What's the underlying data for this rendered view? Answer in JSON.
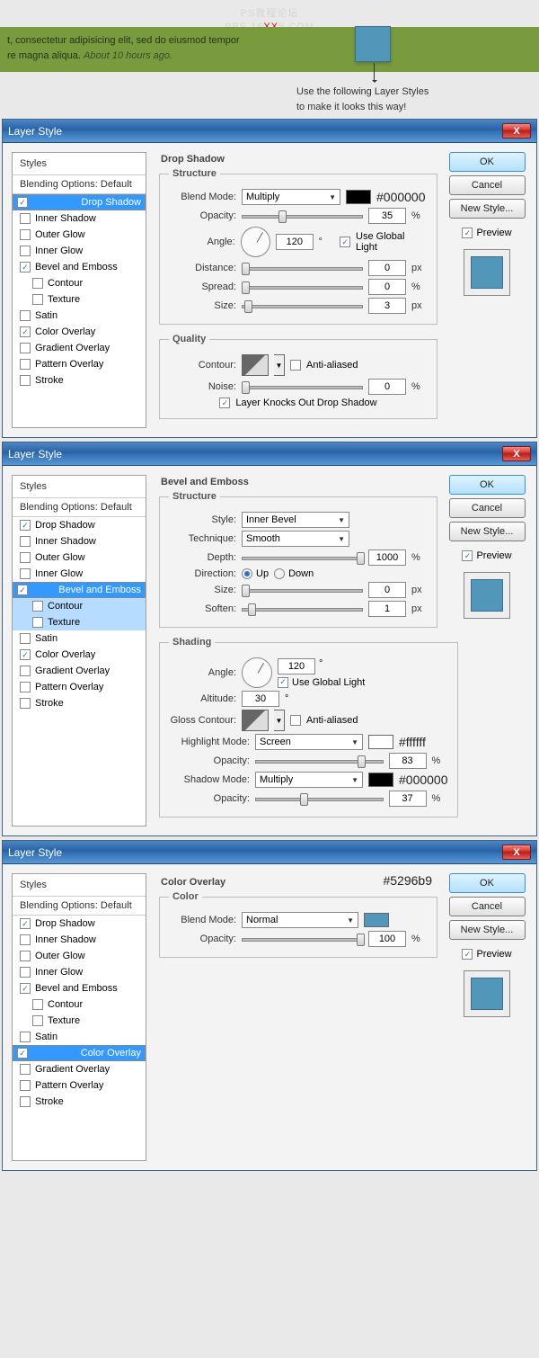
{
  "banner": {
    "watermark1": "PS教程论坛",
    "watermark2_a": "BBS.16",
    "watermark2_b": "XX",
    "watermark2_c": "8.COM",
    "line1": "t, consectetur adipisicing elit, sed do eiusmod tempor",
    "line2": "re magna aliqua.  ",
    "time": "About 10 hours ago.",
    "caption1": "Use the following Layer Styles",
    "caption2": "to make it looks this way!"
  },
  "common": {
    "title": "Layer Style",
    "close": "X",
    "styles_header": "Styles",
    "blend_opts": "Blending Options: Default",
    "ok": "OK",
    "cancel": "Cancel",
    "new_style": "New Style...",
    "preview": "Preview",
    "items": {
      "drop_shadow": "Drop Shadow",
      "inner_shadow": "Inner Shadow",
      "outer_glow": "Outer Glow",
      "inner_glow": "Inner Glow",
      "bevel": "Bevel and Emboss",
      "contour": "Contour",
      "texture": "Texture",
      "satin": "Satin",
      "color_overlay": "Color Overlay",
      "gradient_overlay": "Gradient Overlay",
      "pattern_overlay": "Pattern Overlay",
      "stroke": "Stroke"
    }
  },
  "d1": {
    "section": "Drop Shadow",
    "structure": "Structure",
    "quality": "Quality",
    "blend_mode": "Blend Mode:",
    "bm_val": "Multiply",
    "color": "#000000",
    "opacity": "Opacity:",
    "opacity_v": "35",
    "angle": "Angle:",
    "angle_v": "120",
    "global": "Use Global Light",
    "distance": "Distance:",
    "distance_v": "0",
    "px": "px",
    "spread": "Spread:",
    "spread_v": "0",
    "pct": "%",
    "size": "Size:",
    "size_v": "3",
    "contour": "Contour:",
    "anti": "Anti-aliased",
    "noise": "Noise:",
    "noise_v": "0",
    "knock": "Layer Knocks Out Drop Shadow"
  },
  "d2": {
    "section": "Bevel and Emboss",
    "structure": "Structure",
    "shading": "Shading",
    "style": "Style:",
    "style_v": "Inner Bevel",
    "tech": "Technique:",
    "tech_v": "Smooth",
    "depth": "Depth:",
    "depth_v": "1000",
    "dir": "Direction:",
    "up": "Up",
    "down": "Down",
    "size": "Size:",
    "size_v": "0",
    "px": "px",
    "pct": "%",
    "soften": "Soften:",
    "soften_v": "1",
    "angle": "Angle:",
    "angle_v": "120",
    "global": "Use Global Light",
    "alt": "Altitude:",
    "alt_v": "30",
    "gloss": "Gloss Contour:",
    "anti": "Anti-aliased",
    "hmode": "Highlight Mode:",
    "hmode_v": "Screen",
    "hcolor": "#ffffff",
    "hop": "Opacity:",
    "hop_v": "83",
    "smode": "Shadow Mode:",
    "smode_v": "Multiply",
    "scolor": "#000000",
    "sop": "Opacity:",
    "sop_v": "37"
  },
  "d3": {
    "section": "Color Overlay",
    "color_grp": "Color",
    "blend_mode": "Blend Mode:",
    "bm_val": "Normal",
    "color": "#5296b9",
    "opacity": "Opacity:",
    "opacity_v": "100",
    "pct": "%"
  }
}
